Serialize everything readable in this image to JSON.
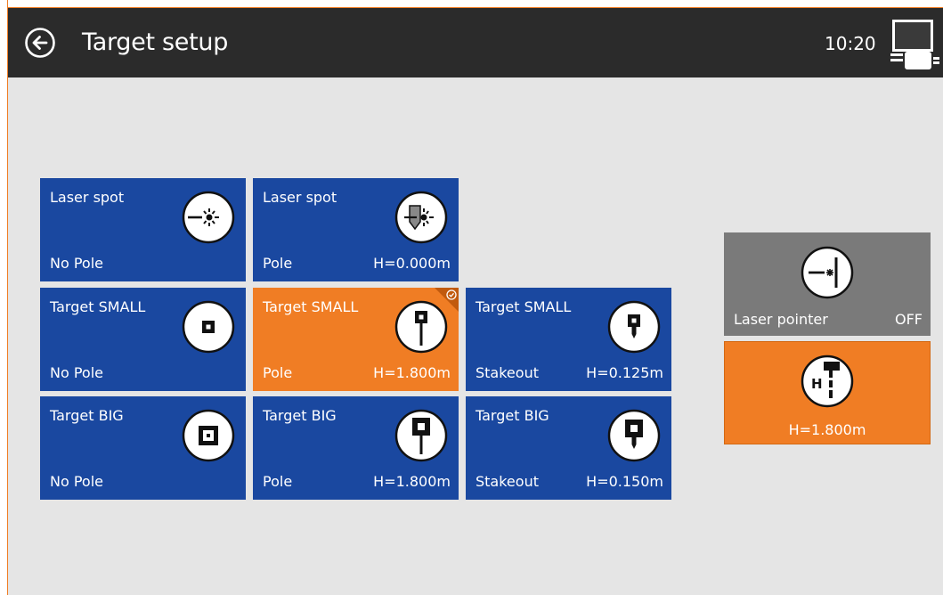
{
  "header": {
    "title": "Target setup",
    "time": "10:20",
    "back_icon": "back-arrow-icon",
    "status_icon": "controller-display-icon"
  },
  "tiles": [
    {
      "name": "Laser spot",
      "pole": "No Pole",
      "height": "",
      "icon": "laser-spot-icon",
      "selected": false
    },
    {
      "name": "Laser spot",
      "pole": "Pole",
      "height": "H=0.000m",
      "icon": "laser-spot-pole-icon",
      "selected": false
    },
    {
      "name": "Target SMALL",
      "pole": "No Pole",
      "height": "",
      "icon": "target-small-icon",
      "selected": false
    },
    {
      "name": "Target SMALL",
      "pole": "Pole",
      "height": "H=1.800m",
      "icon": "target-small-pole-icon",
      "selected": true
    },
    {
      "name": "Target SMALL",
      "pole": "Stakeout",
      "height": "H=0.125m",
      "icon": "target-small-stakeout-icon",
      "selected": false
    },
    {
      "name": "Target BIG",
      "pole": "No Pole",
      "height": "",
      "icon": "target-big-icon",
      "selected": false
    },
    {
      "name": "Target BIG",
      "pole": "Pole",
      "height": "H=1.800m",
      "icon": "target-big-pole-icon",
      "selected": false
    },
    {
      "name": "Target BIG",
      "pole": "Stakeout",
      "height": "H=0.150m",
      "icon": "target-big-stakeout-icon",
      "selected": false
    }
  ],
  "side": {
    "laser_pointer_label": "Laser pointer",
    "laser_pointer_state": "OFF",
    "height_value": "H=1.800m",
    "laser_icon": "laser-pointer-icon",
    "height_icon": "pole-height-icon"
  },
  "colors": {
    "header_bg": "#2b2b2b",
    "tile_blue": "#1a48a0",
    "accent_orange": "#f07d24",
    "tile_gray": "#7a7a7a",
    "background": "#e5e5e5"
  }
}
